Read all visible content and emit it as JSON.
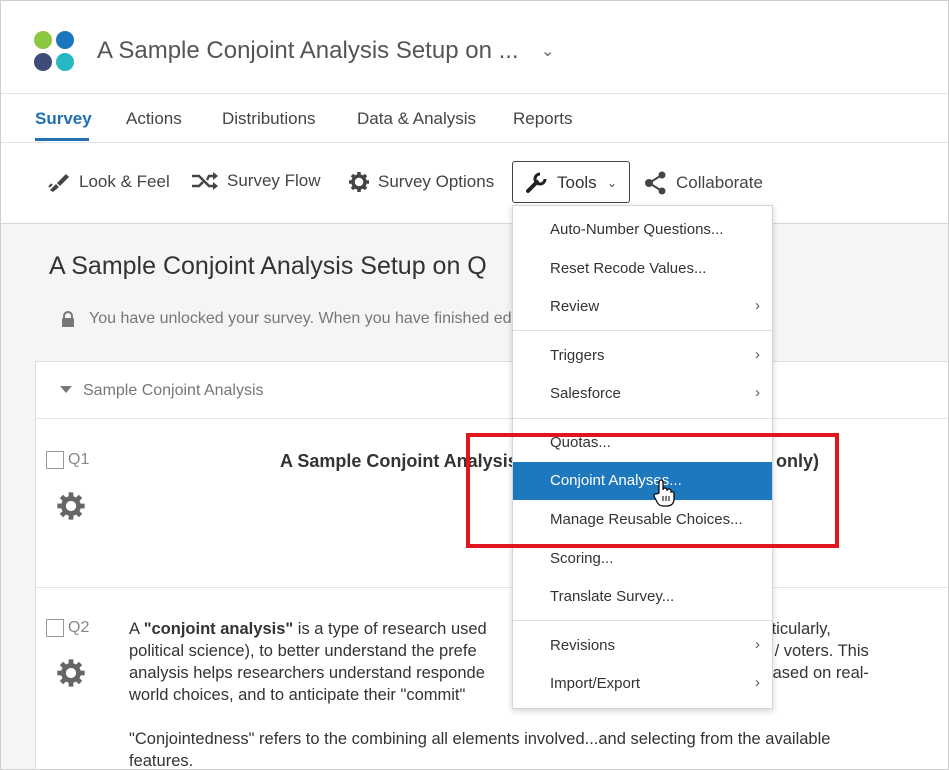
{
  "header": {
    "project_title": "A Sample Conjoint Analysis Setup on ...",
    "logo_colors": [
      "#8dc63f",
      "#1b75bb",
      "#3f4b78",
      "#27b7c1"
    ]
  },
  "tabs": [
    {
      "label": "Survey",
      "active": true
    },
    {
      "label": "Actions"
    },
    {
      "label": "Distributions"
    },
    {
      "label": "Data & Analysis"
    },
    {
      "label": "Reports"
    }
  ],
  "toolbar": {
    "look_feel": "Look & Feel",
    "survey_flow": "Survey Flow",
    "survey_options": "Survey Options",
    "tools": "Tools",
    "collaborate": "Collaborate"
  },
  "survey": {
    "title": "A Sample Conjoint Analysis Setup on Q",
    "lock_notice": "You have unlocked your survey. When you have finished edi",
    "block_name": "Sample Conjoint Analysis",
    "q1": {
      "number": "Q1",
      "text_left": "A Sample Conjoint Analysis",
      "text_right": "only)"
    },
    "q2": {
      "number": "Q2",
      "lines": [
        {
          "prefix": "A ",
          "bold": "\"conjoint analysis\"",
          "rest": " is a type of research used",
          "right": "ces (particularly,"
        },
        {
          "rest": "political science), to better understand the prefe",
          "right": "citizens / voters.  This"
        },
        {
          "rest": "analysis helps researchers understand responde",
          "right": "exts, based on real-"
        },
        {
          "rest": "world choices, and to anticipate their \"commit\""
        },
        {
          "rest": ""
        },
        {
          "rest": "\"Conjointedness\" refers to the combining all elements involved...and selecting from the available"
        },
        {
          "rest": "features."
        }
      ]
    }
  },
  "tools_menu": {
    "items": [
      {
        "label": "Auto-Number Questions...",
        "submenu": false
      },
      {
        "label": "Reset Recode Values...",
        "submenu": false
      },
      {
        "label": "Review",
        "submenu": true
      },
      {
        "label": "Triggers",
        "submenu": true
      },
      {
        "label": "Salesforce",
        "submenu": true
      },
      {
        "label": "Quotas...",
        "submenu": false
      },
      {
        "label": "Conjoint Analyses...",
        "submenu": false,
        "highlighted": true
      },
      {
        "label": "Manage Reusable Choices...",
        "submenu": false
      },
      {
        "label": "Scoring...",
        "submenu": false
      },
      {
        "label": "Translate Survey...",
        "submenu": false
      },
      {
        "label": "Revisions",
        "submenu": true
      },
      {
        "label": "Import/Export",
        "submenu": true
      }
    ],
    "chevron": "›"
  },
  "colors": {
    "accent": "#1f6fb2",
    "highlight": "#1d78be",
    "annotation_red": "#e0161c"
  }
}
